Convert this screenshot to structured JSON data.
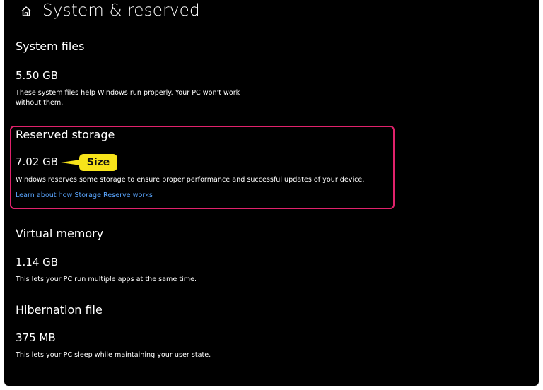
{
  "header": {
    "title": "System & reserved",
    "icon": "home-icon"
  },
  "sections": [
    {
      "title": "System files",
      "size": "5.50 GB",
      "description_line1": "These system files help Windows run properly. Your PC won't work",
      "description_line2": "without them."
    },
    {
      "title": "Reserved storage",
      "size": "7.02 GB",
      "description": "Windows reserves some storage to ensure proper performance and successful updates of your device.",
      "link": "Learn about how Storage Reserve works"
    },
    {
      "title": "Virtual memory",
      "size": "1.14 GB",
      "description": "This lets your PC run multiple apps at the same time."
    },
    {
      "title": "Hibernation file",
      "size": "375 MB",
      "description": "This lets your PC sleep while maintaining your user state."
    }
  ],
  "annotation": {
    "callout_label": "Size",
    "callout_color": "#f7e31a",
    "highlight_color": "#e0226b"
  }
}
